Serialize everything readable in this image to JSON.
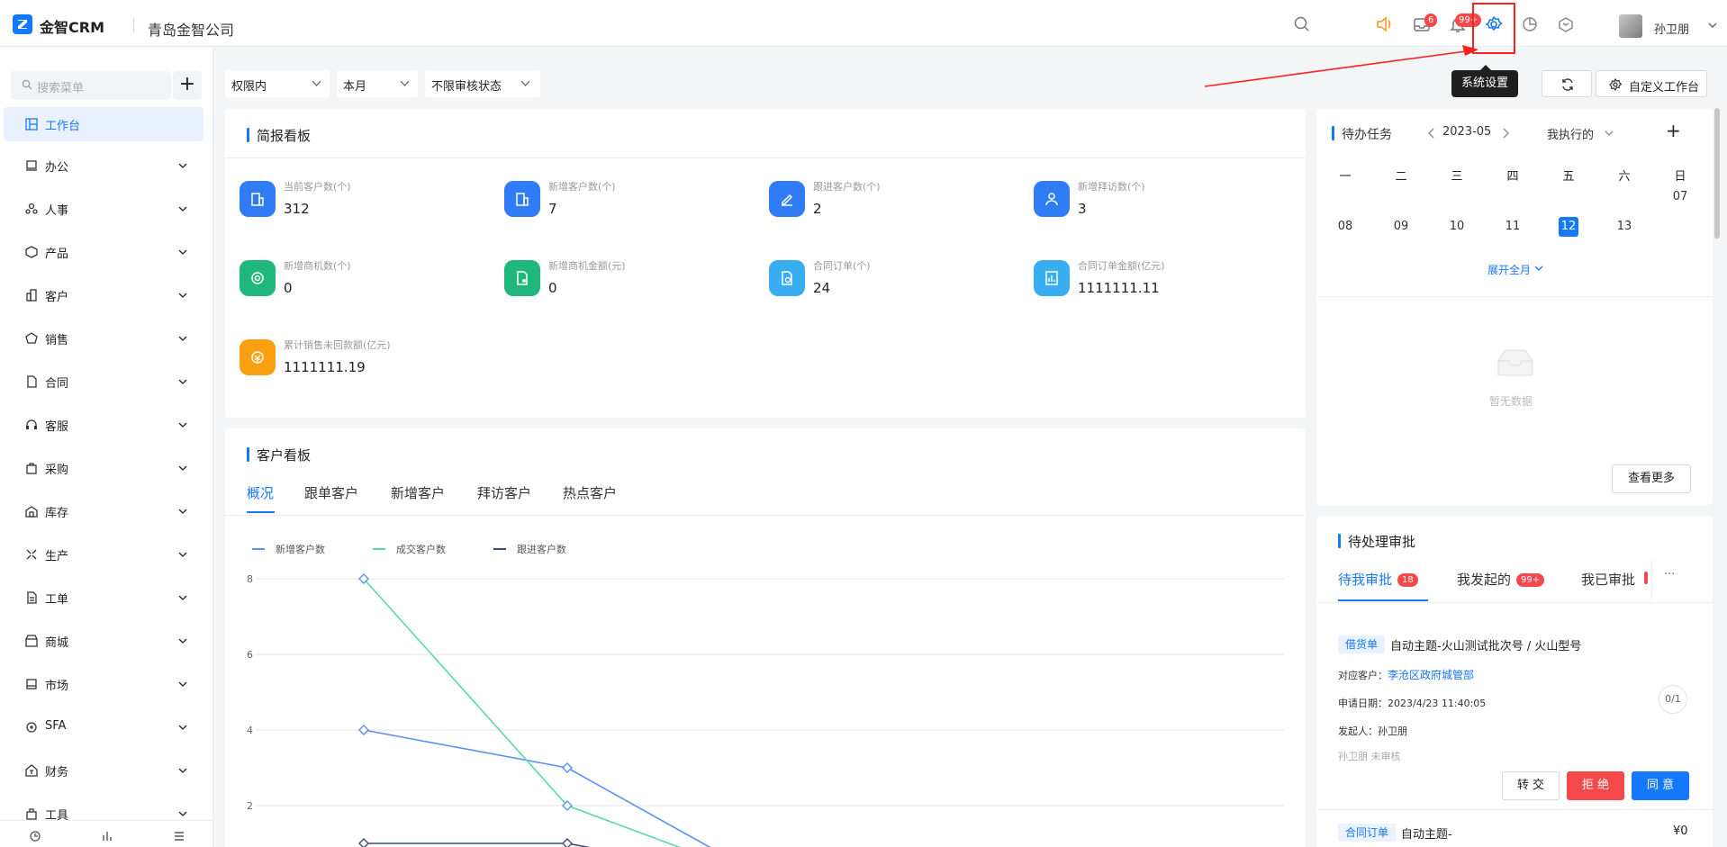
{
  "header": {
    "brand": "金智CRM",
    "company": "青岛金智公司",
    "mail_badge": "6",
    "bell_badge": "99+",
    "username": "孙卫朋",
    "tooltip": "系统设置"
  },
  "sidebar": {
    "search_placeholder": "搜索菜单",
    "add_label": "+",
    "items": [
      {
        "label": "工作台",
        "icon": "dashboard-icon"
      },
      {
        "label": "办公",
        "icon": "office-icon"
      },
      {
        "label": "人事",
        "icon": "hr-icon"
      },
      {
        "label": "产品",
        "icon": "product-icon"
      },
      {
        "label": "客户",
        "icon": "customer-icon"
      },
      {
        "label": "销售",
        "icon": "sales-icon"
      },
      {
        "label": "合同",
        "icon": "contract-icon"
      },
      {
        "label": "客服",
        "icon": "service-icon"
      },
      {
        "label": "采购",
        "icon": "purchase-icon"
      },
      {
        "label": "库存",
        "icon": "inventory-icon"
      },
      {
        "label": "生产",
        "icon": "production-icon"
      },
      {
        "label": "工单",
        "icon": "workorder-icon"
      },
      {
        "label": "商城",
        "icon": "mall-icon"
      },
      {
        "label": "市场",
        "icon": "market-icon"
      },
      {
        "label": "SFA",
        "icon": "sfa-icon"
      },
      {
        "label": "财务",
        "icon": "finance-icon"
      },
      {
        "label": "工具",
        "icon": "tools-icon"
      }
    ]
  },
  "filters": {
    "scope": "权限内",
    "period": "本月",
    "audit": "不限审核状态",
    "custom_button": "自定义工作台"
  },
  "briefing": {
    "title": "简报看板",
    "stats": [
      {
        "label": "当前客户数(个)",
        "value": "312",
        "color": "#2f7cf6"
      },
      {
        "label": "新增客户数(个)",
        "value": "7",
        "color": "#2f7cf6"
      },
      {
        "label": "跟进客户数(个)",
        "value": "2",
        "color": "#2f7cf6"
      },
      {
        "label": "新增拜访数(个)",
        "value": "3",
        "color": "#2f7cf6"
      },
      {
        "label": "新增商机数(个)",
        "value": "0",
        "color": "#1fb87a"
      },
      {
        "label": "新增商机金额(元)",
        "value": "0",
        "color": "#1fb87a"
      },
      {
        "label": "合同订单(个)",
        "value": "24",
        "color": "#38aef0"
      },
      {
        "label": "合同订单金额(亿元)",
        "value": "1111111.11",
        "color": "#38aef0"
      },
      {
        "label": "累计销售未回款额(亿元)",
        "value": "1111111.19",
        "color": "#fa9f0f"
      }
    ]
  },
  "customer_board": {
    "title": "客户看板",
    "tabs": [
      "概况",
      "跟单客户",
      "新增客户",
      "拜访客户",
      "热点客户"
    ]
  },
  "chart_data": {
    "type": "line",
    "ylim": [
      0,
      8
    ],
    "yticks": [
      "8",
      "6",
      "4",
      "2"
    ],
    "series": [
      {
        "name": "新增客户数",
        "color": "#5b8ff9",
        "values": [
          4,
          3,
          0
        ]
      },
      {
        "name": "成交客户数",
        "color": "#5ad8a6",
        "values": [
          8,
          2,
          0
        ]
      },
      {
        "name": "跟进客户数",
        "color": "#3b4d7a",
        "values": [
          1,
          1,
          0
        ]
      }
    ]
  },
  "todo": {
    "title": "待办任务",
    "month": "2023-05",
    "filter": "我执行的",
    "weekdays": [
      "一",
      "二",
      "三",
      "四",
      "五",
      "六",
      "日"
    ],
    "days_row1": [
      "",
      "",
      "",
      "",
      "",
      "",
      "07"
    ],
    "days_row2": [
      "08",
      "09",
      "10",
      "11",
      "12",
      "13",
      ""
    ],
    "selected": "12",
    "expand": "展开全月",
    "empty": "暂无数据",
    "more": "查看更多"
  },
  "approval": {
    "title": "待处理审批",
    "tabs": [
      {
        "label": "待我审批",
        "badge": "18"
      },
      {
        "label": "我发起的",
        "badge": "99+"
      },
      {
        "label": "我已审批",
        "badge": ""
      }
    ],
    "more": "···",
    "item": {
      "tag": "借货单",
      "subject": "自动主题-火山测试批次号 / 火山型号",
      "customer_label": "对应客户：",
      "customer": "李沧区政府城管部",
      "date_label": "申请日期：",
      "date": "2023/4/23 11:40:05",
      "initiator_label": "发起人：",
      "initiator": "孙卫朋",
      "status": "孙卫朋 未审核",
      "progress": "0/1",
      "btn_transfer": "转 交",
      "btn_reject": "拒 绝",
      "btn_agree": "同 意"
    },
    "item2": {
      "tag": "合同订单",
      "subject": "自动主题-",
      "amount": "¥0"
    }
  }
}
